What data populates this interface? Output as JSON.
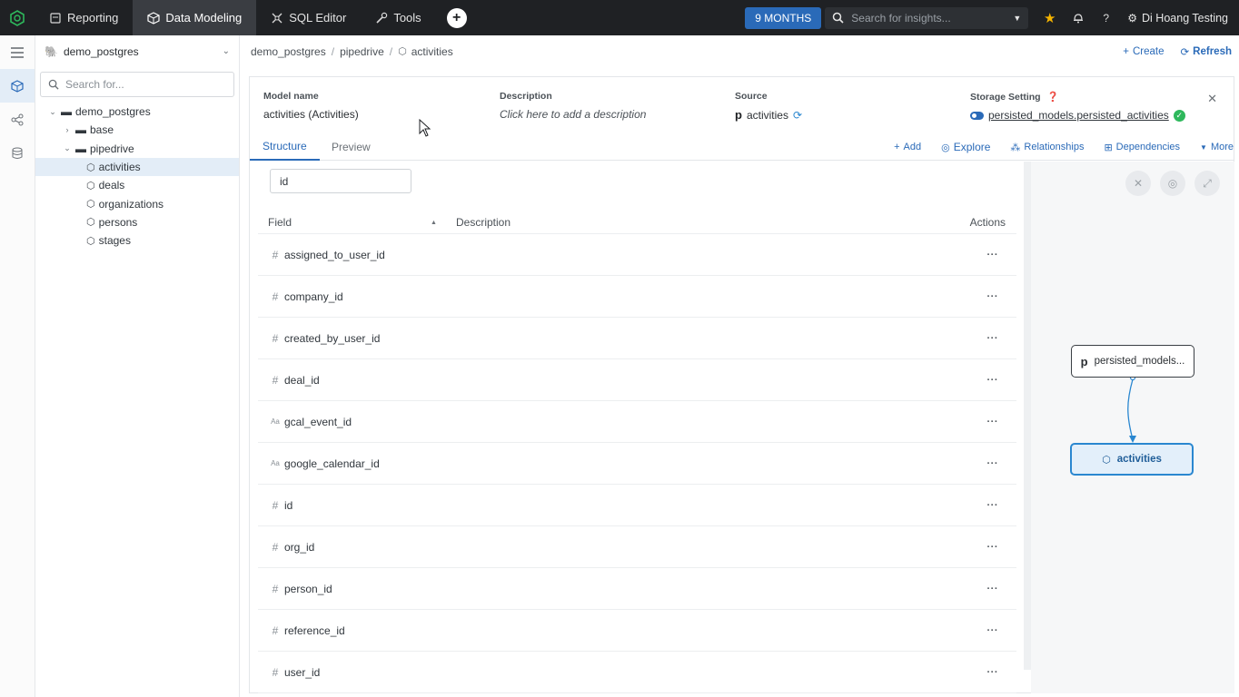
{
  "topnav": {
    "tabs": [
      {
        "label": "Reporting",
        "icon": "reporting-icon"
      },
      {
        "label": "Data Modeling",
        "icon": "cube-icon"
      },
      {
        "label": "SQL Editor",
        "icon": "sql-icon"
      },
      {
        "label": "Tools",
        "icon": "wrench-icon"
      }
    ],
    "active_tab": "Data Modeling",
    "date_range": "9 MONTHS",
    "search_placeholder": "Search for insights...",
    "user_name": "Di Hoang Testing"
  },
  "sidebar": {
    "datasource": "demo_postgres",
    "search_placeholder": "Search for...",
    "tree": [
      {
        "label": "demo_postgres",
        "type": "folder",
        "depth": 0,
        "expanded": true
      },
      {
        "label": "base",
        "type": "folder",
        "depth": 1,
        "expanded": false
      },
      {
        "label": "pipedrive",
        "type": "folder",
        "depth": 1,
        "expanded": true
      },
      {
        "label": "activities",
        "type": "model",
        "depth": 2,
        "selected": true
      },
      {
        "label": "deals",
        "type": "model",
        "depth": 2
      },
      {
        "label": "organizations",
        "type": "model",
        "depth": 2
      },
      {
        "label": "persons",
        "type": "model",
        "depth": 2
      },
      {
        "label": "stages",
        "type": "model",
        "depth": 2
      }
    ]
  },
  "breadcrumb": {
    "items": [
      "demo_postgres",
      "pipedrive",
      "activities"
    ],
    "create_label": "Create",
    "refresh_label": "Refresh"
  },
  "model": {
    "name_label": "Model name",
    "name_value": "activities (Activities)",
    "description_label": "Description",
    "description_value": "Click here to add a description",
    "source_label": "Source",
    "source_value": "activities",
    "storage_label": "Storage Setting",
    "storage_value": "persisted_models.persisted_activities"
  },
  "tabs": {
    "structure": "Structure",
    "preview": "Preview",
    "actions": {
      "add": "Add",
      "explore": "Explore",
      "relationships": "Relationships",
      "dependencies": "Dependencies",
      "more": "More"
    }
  },
  "table": {
    "filter_value": "id",
    "headers": {
      "field": "Field",
      "description": "Description",
      "actions": "Actions"
    },
    "rows": [
      {
        "type": "#",
        "name": "assigned_to_user_id"
      },
      {
        "type": "#",
        "name": "company_id"
      },
      {
        "type": "#",
        "name": "created_by_user_id"
      },
      {
        "type": "#",
        "name": "deal_id"
      },
      {
        "type": "Aa",
        "name": "gcal_event_id"
      },
      {
        "type": "Aa",
        "name": "google_calendar_id"
      },
      {
        "type": "#",
        "name": "id"
      },
      {
        "type": "#",
        "name": "org_id"
      },
      {
        "type": "#",
        "name": "person_id"
      },
      {
        "type": "#",
        "name": "reference_id"
      },
      {
        "type": "#",
        "name": "user_id"
      }
    ],
    "row_action": "···"
  },
  "diagram": {
    "source_node": "persisted_models...",
    "model_node": "activities"
  },
  "colors": {
    "accent": "#2a6ab8",
    "topbar": "#1f2124",
    "success": "#2eb85c",
    "star": "#f5b400"
  }
}
